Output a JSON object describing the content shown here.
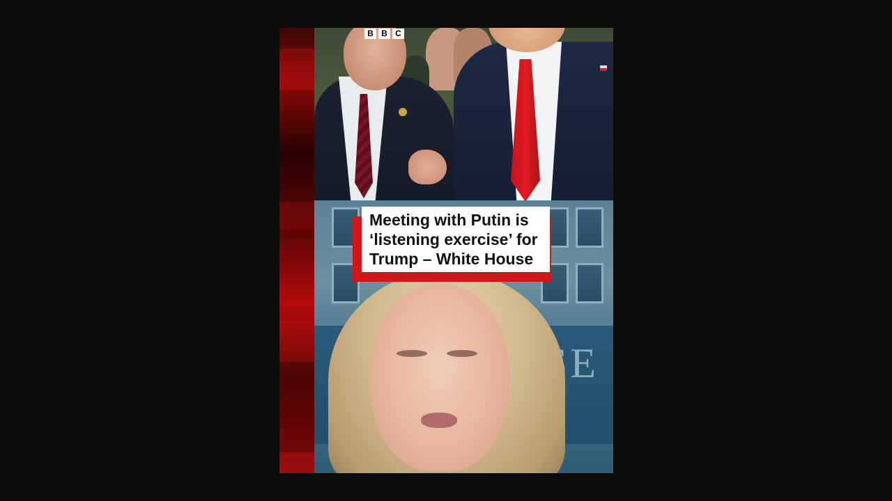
{
  "logo": {
    "letters": [
      "B",
      "B",
      "C"
    ]
  },
  "headline": {
    "line1": "Meeting with Putin is",
    "line2": "‘listening exercise’ for",
    "line3": "Trump – White House"
  },
  "background": {
    "seal_text": "SE"
  },
  "colors": {
    "accent_red": "#d0181b",
    "page_background": "#0b0b0b"
  }
}
